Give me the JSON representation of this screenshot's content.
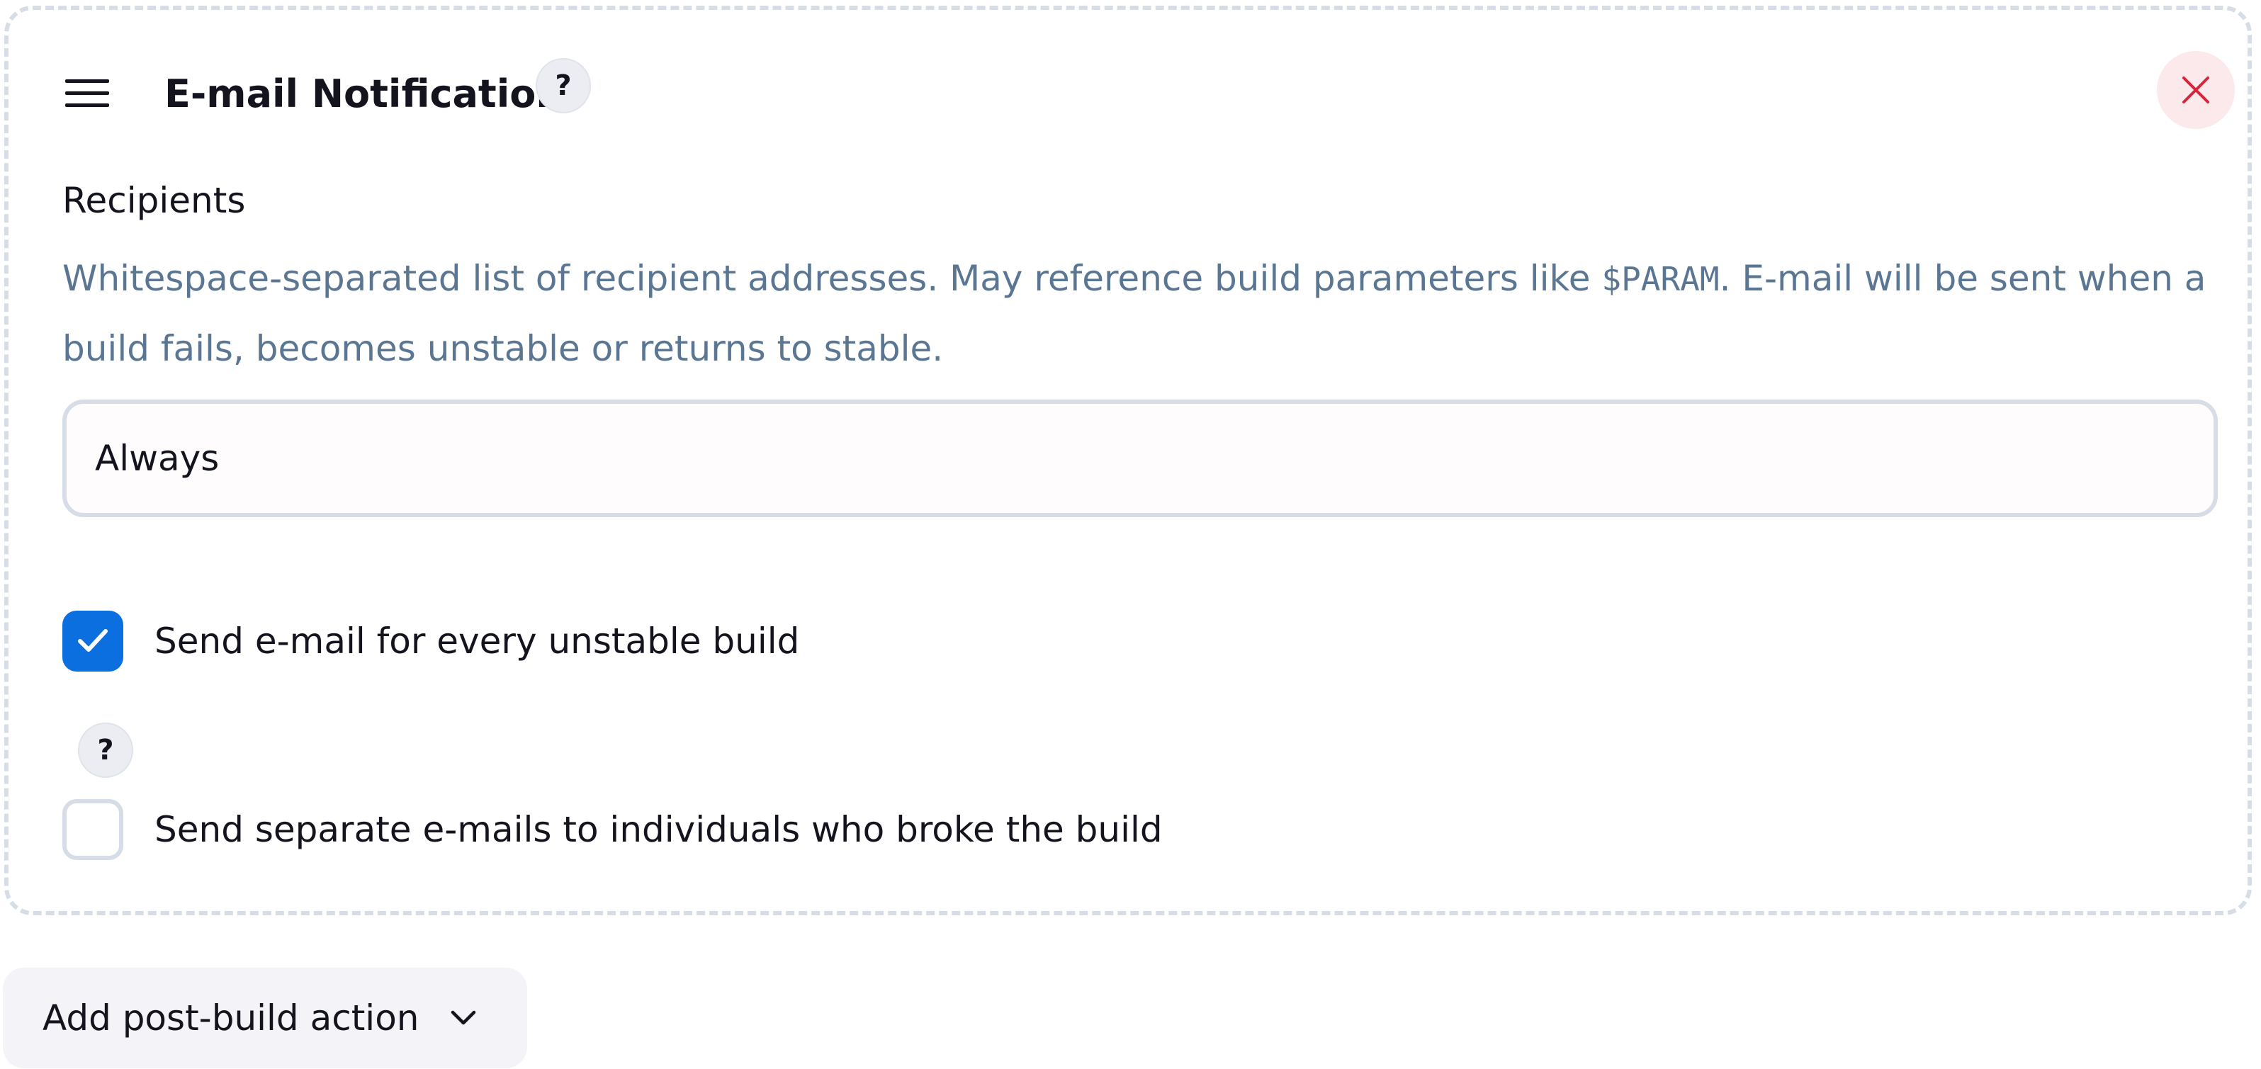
{
  "section": {
    "title": "E-mail Notification",
    "help_label": "?",
    "close_label": "Close"
  },
  "recipients": {
    "label": "Recipients",
    "description_before": "Whitespace-separated list of recipient addresses. May reference build parameters like ",
    "description_code": "$PARAM",
    "description_after": ". E-mail will be sent when a build fails, becomes unstable or returns to stable.",
    "value": "Always"
  },
  "options": [
    {
      "label": "Send e-mail for every unstable build",
      "checked": true
    },
    {
      "label": "Send separate e-mails to individuals who broke the build",
      "checked": false
    }
  ],
  "options_help_label": "?",
  "add_action": {
    "label": "Add post-build action"
  },
  "colors": {
    "accent": "#0b6fdf",
    "description_text": "#5b7693",
    "close_icon": "#d6243c",
    "close_bg": "#fbe9ec",
    "border": "#d6dde6"
  },
  "icons": {
    "drag": "hamburger-drag-icon",
    "close": "close-x-icon",
    "check": "check-icon",
    "dropdown": "chevron-down-icon"
  }
}
